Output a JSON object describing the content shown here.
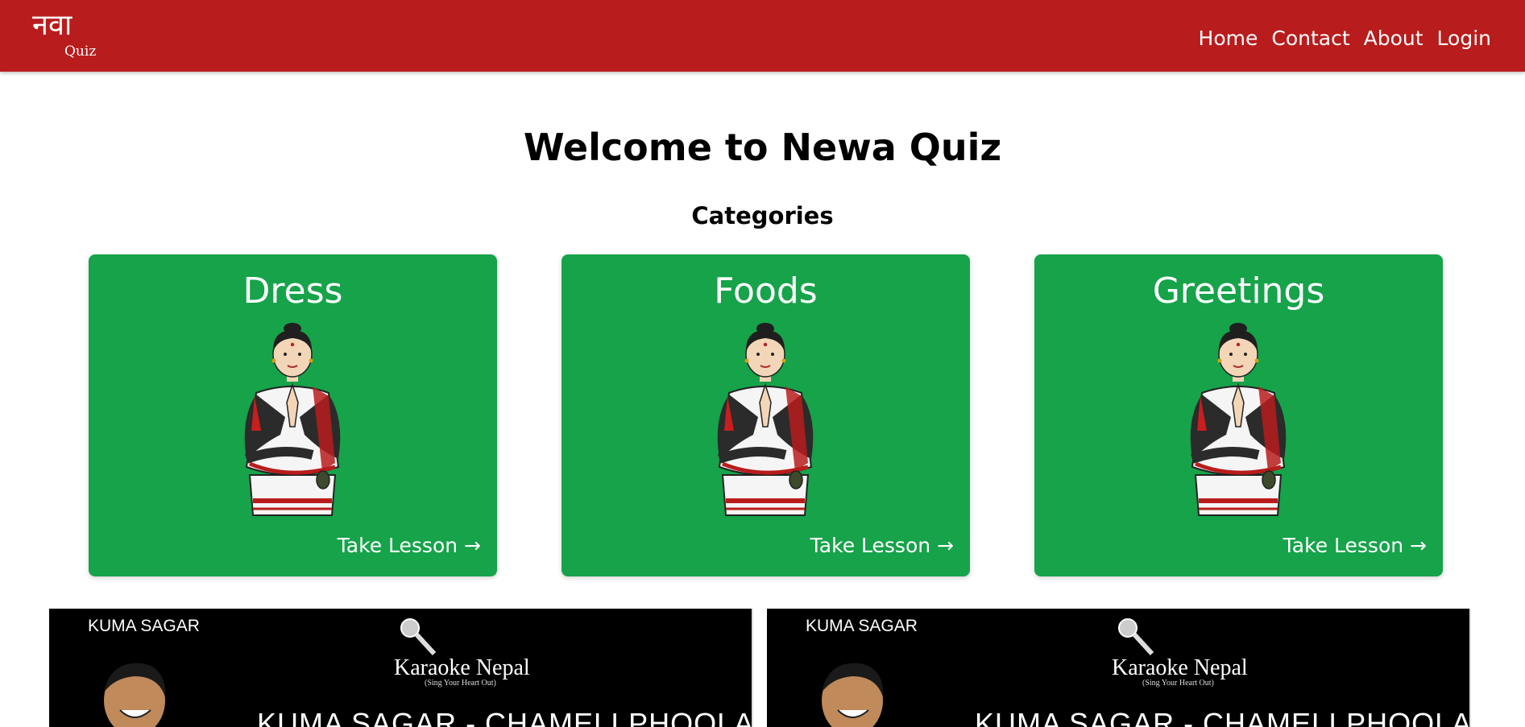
{
  "navbar": {
    "logo_text": "नवा",
    "logo_sub": "Quiz",
    "links": [
      "Home",
      "Contact",
      "About",
      "Login"
    ]
  },
  "main": {
    "title": "Welcome to Newa Quiz",
    "subtitle": "Categories",
    "categories": [
      {
        "title": "Dress",
        "link": "Take Lesson →",
        "icon": "namaste-girl-illustration"
      },
      {
        "title": "Foods",
        "link": "Take Lesson →",
        "icon": "namaste-girl-illustration"
      },
      {
        "title": "Greetings",
        "link": "Take Lesson →",
        "icon": "namaste-girl-illustration"
      }
    ]
  },
  "videos": [
    {
      "artist": "KUMA SAGAR",
      "brand": "Karaoke Nepal",
      "tagline": "(Sing Your Heart Out)",
      "song": "KUMA SAGAR - CHAMELI PHOOLA"
    },
    {
      "artist": "KUMA SAGAR",
      "brand": "Karaoke Nepal",
      "tagline": "(Sing Your Heart Out)",
      "song": "KUMA SAGAR - CHAMELI PHOOLA"
    }
  ],
  "colors": {
    "navbar": "#b91c1c",
    "card": "#16a34a",
    "video_bg": "#000000"
  }
}
